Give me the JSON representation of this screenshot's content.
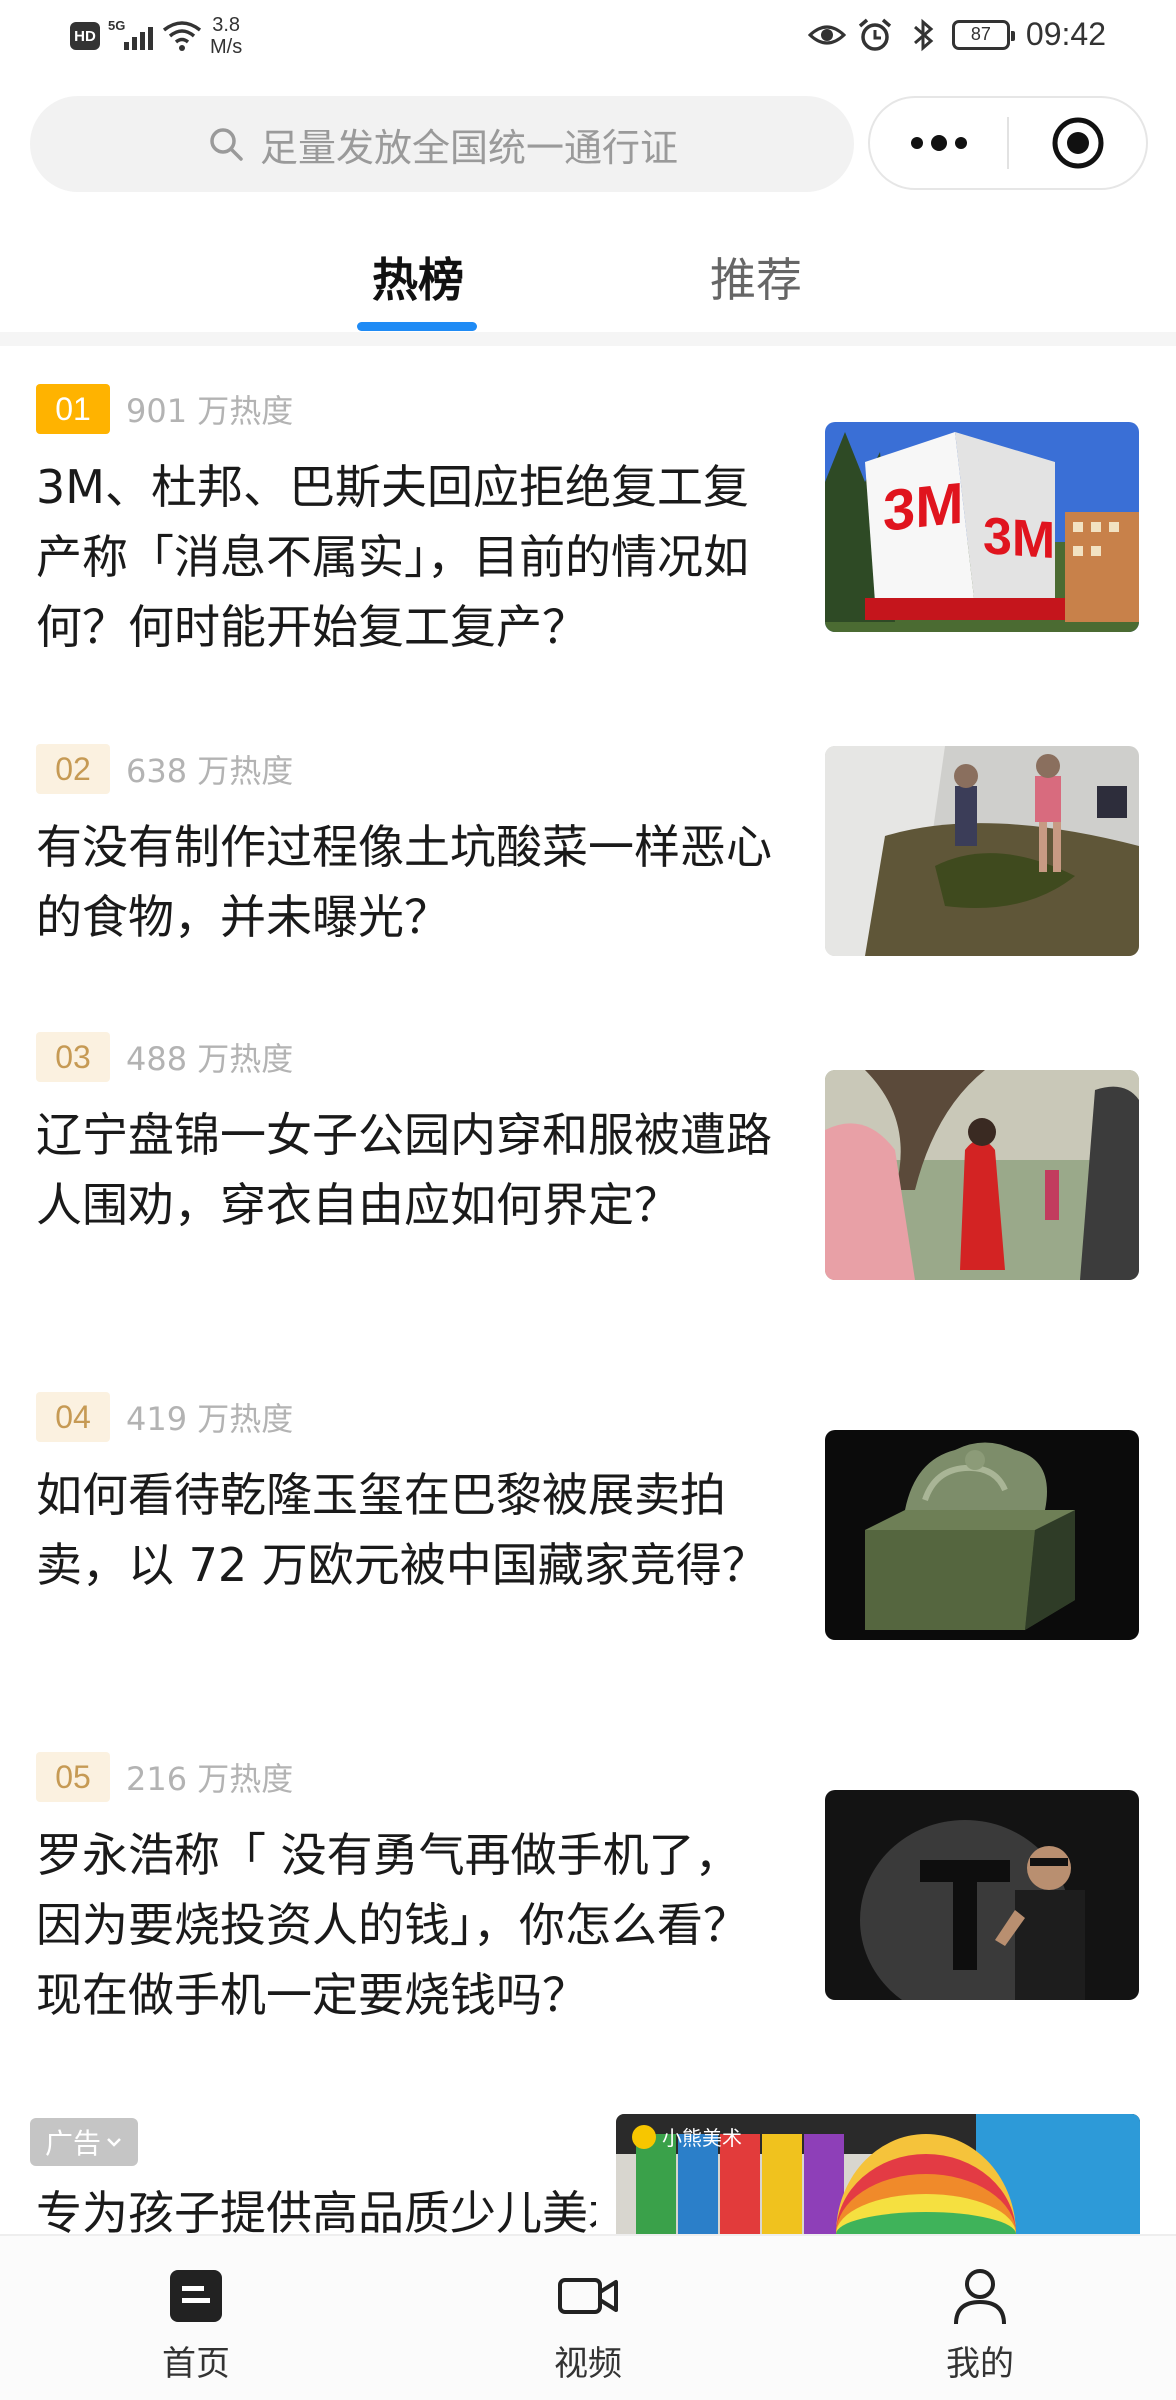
{
  "status_bar": {
    "hd": "HD",
    "network": "5G",
    "speed_value": "3.8",
    "speed_unit": "M/s",
    "battery": "87",
    "time": "09:42",
    "icons": [
      "eye-icon",
      "alarm-icon",
      "bluetooth-icon",
      "battery-icon"
    ]
  },
  "search": {
    "placeholder": "足量发放全国统一通行证"
  },
  "capsule": {
    "icons": [
      "more-icon",
      "close-target-icon"
    ]
  },
  "tabs": [
    {
      "label": "热榜",
      "active": true
    },
    {
      "label": "推荐",
      "active": false
    }
  ],
  "hot_list": [
    {
      "rank": "01",
      "heat": "901 万热度",
      "title": "3M、杜邦、巴斯夫回应拒绝复工复产称「消息不属实」，目前的情况如何？何时能开始复工复产？",
      "image": "3m-building-photo"
    },
    {
      "rank": "02",
      "heat": "638 万热度",
      "title": "有没有制作过程像土坑酸菜一样恶心的食物，并未曝光？",
      "image": "pickled-vegetable-pit-photo"
    },
    {
      "rank": "03",
      "heat": "488 万热度",
      "title": "辽宁盘锦一女子公园内穿和服被遭路人围劝，穿衣自由应如何界定？",
      "image": "park-crowd-photo"
    },
    {
      "rank": "04",
      "heat": "419 万热度",
      "title": "如何看待乾隆玉玺在巴黎被展卖拍卖，以 72 万欧元被中国藏家竞得？",
      "image": "jade-seal-photo"
    },
    {
      "rank": "05",
      "heat": "216 万热度",
      "title": "罗永浩称「 没有勇气再做手机了，因为要烧投资人的钱」，你怎么看？现在做手机一定要烧钱吗？",
      "image": "speaker-stage-photo"
    }
  ],
  "ad": {
    "tag": "广告",
    "title": "专为孩子提供高品质少儿美术",
    "brand": "小熊美术"
  },
  "bottom_nav": [
    {
      "label": "首页",
      "icon": "home-icon"
    },
    {
      "label": "视频",
      "icon": "video-icon"
    },
    {
      "label": "我的",
      "icon": "profile-icon"
    }
  ]
}
